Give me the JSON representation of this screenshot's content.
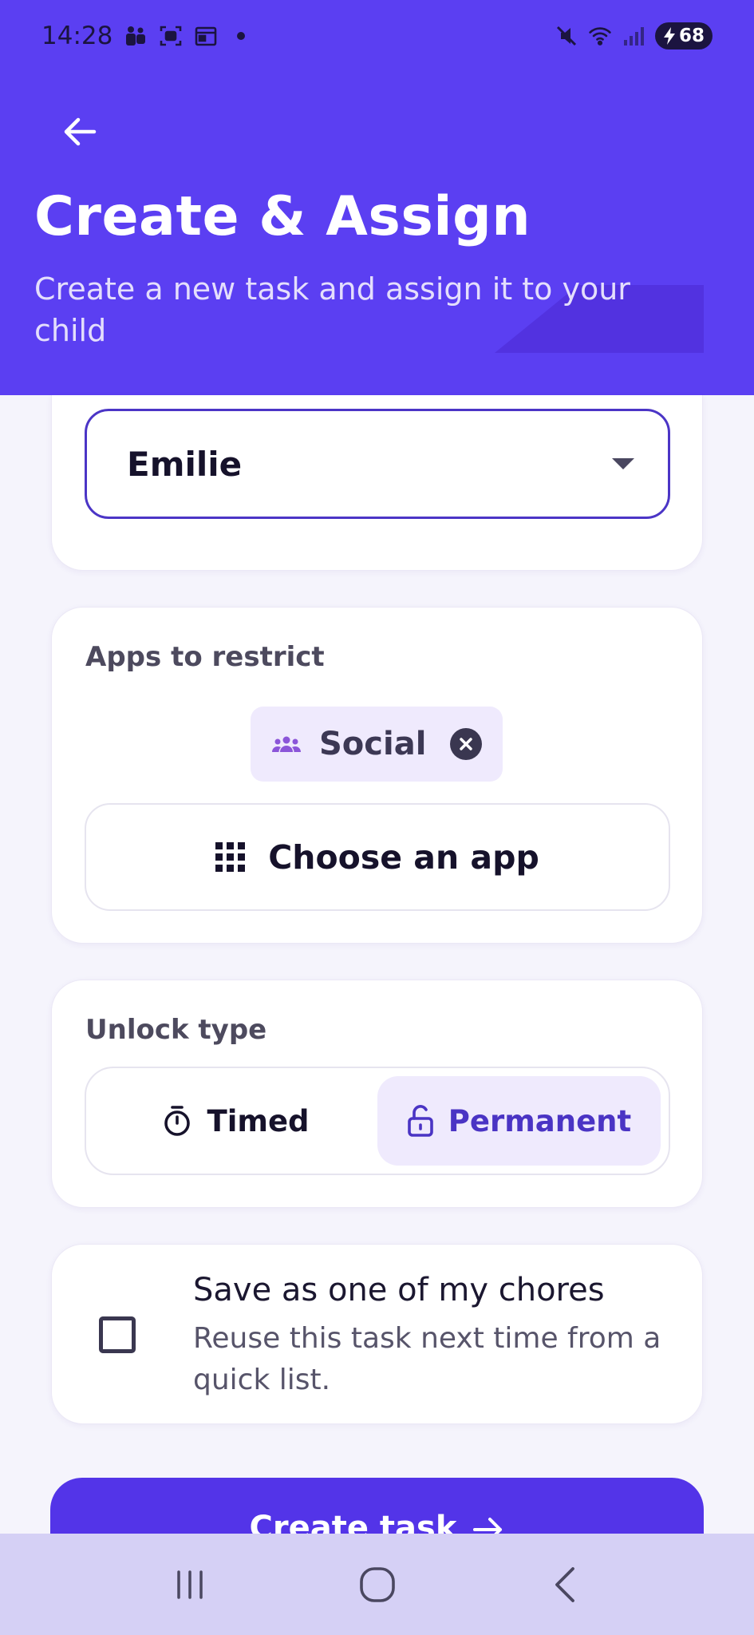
{
  "status_bar": {
    "time": "14:28",
    "battery": "68",
    "left_icons": [
      "teams-icon",
      "screen-record-icon",
      "calendar-icon",
      "notification-dot"
    ],
    "right_icons": [
      "mute-icon",
      "wifi-icon",
      "signal-icon",
      "battery-charging-icon"
    ]
  },
  "header": {
    "title": "Create & Assign",
    "subtitle": "Create a new task and assign it to your child",
    "background_color": "#5b3ff2"
  },
  "child_select": {
    "value": "Emilie"
  },
  "apps_card": {
    "label": "Apps to restrict",
    "chips": [
      {
        "label": "Social",
        "icon": "people-group-icon"
      }
    ],
    "choose_label": "Choose an app"
  },
  "unlock_card": {
    "label": "Unlock type",
    "options": [
      {
        "label": "Timed",
        "icon": "timer-icon",
        "selected": false
      },
      {
        "label": "Permanent",
        "icon": "unlock-icon",
        "selected": true
      }
    ]
  },
  "chores_card": {
    "checked": false,
    "title": "Save as one of my chores",
    "description": "Reuse this task next time from a quick list."
  },
  "primary_action": {
    "label": "Create task"
  },
  "colors": {
    "accent": "#5b3ff2",
    "button": "#5334e8",
    "active_segment_bg": "#efeafd",
    "active_segment_text": "#4a34c4",
    "nav_bar": "#d5d0f5"
  }
}
